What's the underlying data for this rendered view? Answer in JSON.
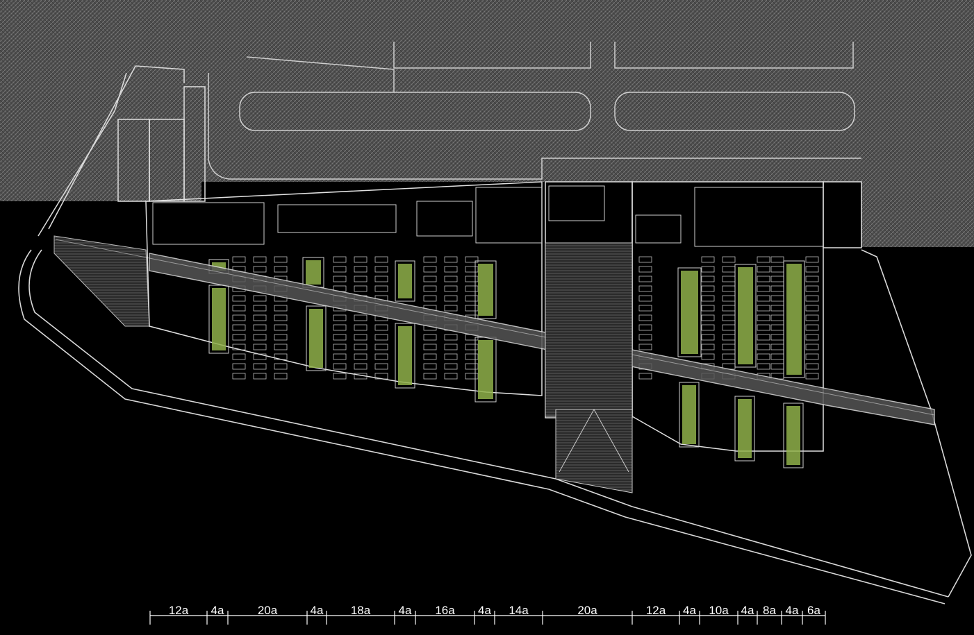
{
  "drawing": {
    "background_color": "#000000",
    "hatch_color": "#5a5a5a",
    "line_color": "#d8d8d8",
    "green_color": "#8fb04a"
  },
  "dimension_bar": {
    "labels": [
      "12a",
      "4a",
      "20a",
      "4a",
      "18a",
      "4a",
      "16a",
      "4a",
      "14a",
      "20a",
      "12a",
      "4a",
      "10a",
      "4a",
      "8a",
      "4a",
      "6a"
    ]
  }
}
